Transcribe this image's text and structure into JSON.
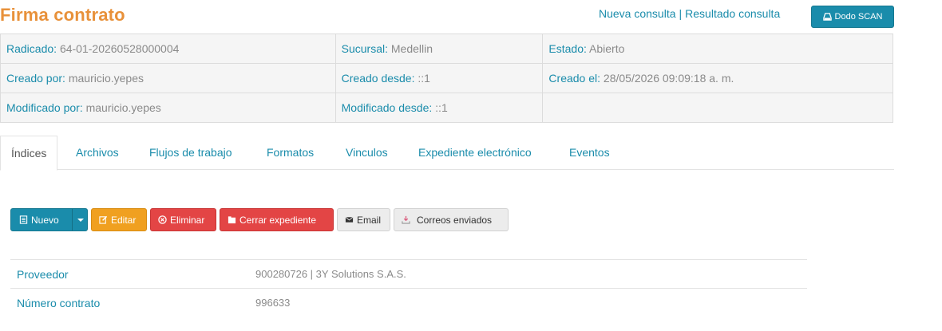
{
  "header": {
    "title": "Firma contrato",
    "links": [
      "Nueva consulta",
      "Resultado consulta"
    ],
    "scan_button": "Dodo SCAN"
  },
  "info": [
    [
      {
        "label": "Radicado:",
        "value": "64-01-20260528000004"
      },
      {
        "label": "Sucursal:",
        "value": "Medellin"
      },
      {
        "label": "Estado:",
        "value": "Abierto"
      }
    ],
    [
      {
        "label": "Creado por:",
        "value": "mauricio.yepes"
      },
      {
        "label": "Creado desde:",
        "value": "::1"
      },
      {
        "label": "Creado el:",
        "value": "28/05/2026 09:09:18 a. m."
      }
    ],
    [
      {
        "label": "Modificado por:",
        "value": "mauricio.yepes"
      },
      {
        "label": "Modificado desde:",
        "value": "::1"
      },
      {
        "label": "",
        "value": ""
      }
    ]
  ],
  "tabs": [
    "Índices",
    "Archivos",
    "Flujos de trabajo",
    "Formatos",
    "Vinculos",
    "Expediente electrónico",
    "Eventos"
  ],
  "active_tab": "Índices",
  "toolbar": {
    "nuevo": "Nuevo",
    "editar": "Editar",
    "eliminar": "Eliminar",
    "cerrar": "Cerrar expediente",
    "email": "Email",
    "correos": "Correos enviados"
  },
  "fields": [
    {
      "label": "Proveedor",
      "value": "900280726 | 3Y Solutions S.A.S."
    },
    {
      "label": "Número contrato",
      "value": "996633"
    }
  ],
  "colors": {
    "accent": "#1a8cab",
    "title": "#e8913a",
    "warning": "#f0a020",
    "danger": "#e34545"
  }
}
